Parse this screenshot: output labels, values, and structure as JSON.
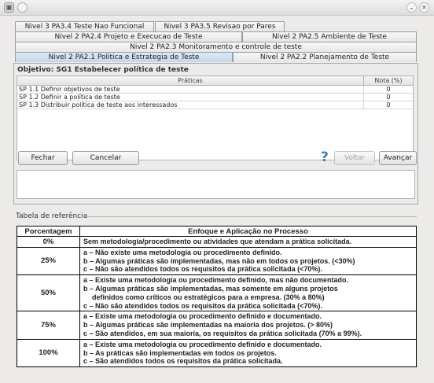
{
  "window": {
    "app_icon": "app-window-icon",
    "minimize_glyph": "⌄",
    "close_glyph": "✕"
  },
  "tabs": {
    "row1": [
      {
        "label": "Nivel 3 PA3.4 Teste Nao Funcional"
      },
      {
        "label": "Nivel 3 PA3.5 Revisao por Pares"
      }
    ],
    "row2": [
      {
        "label": "Nivel 2 PA2.4 Projeto e Execucao de Teste"
      },
      {
        "label": "Nivel 2 PA2.5 Ambiente de Teste"
      }
    ],
    "row3": [
      {
        "label": "Nivel 2 PA2.3 Monitoramento e controle de teste"
      }
    ],
    "row4": [
      {
        "label": "Nivel 2 PA2.1 Politica e Estrategia de Teste",
        "active": true
      },
      {
        "label": "Nivel 2 PA2.2 Planejamento de Teste"
      }
    ]
  },
  "panel": {
    "objective": "Objetivo: SG1 Estabelecer política de teste",
    "grid": {
      "columns": [
        "Práticas",
        "Nota (%)"
      ],
      "rows": [
        {
          "pratica": "SP 1.1 Definir objetivos de teste",
          "nota": "0"
        },
        {
          "pratica": "SP 1.2 Definir a política de teste",
          "nota": "0"
        },
        {
          "pratica": "SP 1.3 Distribuir política de teste aos interessados",
          "nota": "0"
        }
      ]
    },
    "buttons": {
      "fechar": "Fechar",
      "cancelar": "Cancelar",
      "help": "?",
      "voltar": "Voltar",
      "avancar": "Avançar"
    },
    "notes_text": ""
  },
  "reference": {
    "title": "Tabela de referência",
    "headers": [
      "Porcentagem",
      "Enfoque e Aplicação no Processo"
    ],
    "rows": [
      {
        "pct": "0%",
        "lines": [
          {
            "text": "Sem metodologia/procedimento ou atividades que atendam a prática solicitada."
          }
        ]
      },
      {
        "pct": "25%",
        "lines": [
          {
            "text": "a – Não existe uma metodologia ou procedimento definido."
          },
          {
            "text": "b – Algumas práticas são implementadas, mas não em todos os projetos. (<30%)"
          },
          {
            "text": "c – Não são atendidos todos os requisitos da prática solicitada (<70%)."
          }
        ]
      },
      {
        "pct": "50%",
        "lines": [
          {
            "text": "a – Existe uma metodologia ou procedimento definido, mas não documentado."
          },
          {
            "text": "b – Algumas práticas são implementadas, mas somente em alguns projetos"
          },
          {
            "text": "definidos como críticos ou estratégicos para a empresa. (30% a 80%)",
            "indent": true
          },
          {
            "text": "c – Não são atendidos todos os requisitos da prática solicitada (<70%)."
          }
        ]
      },
      {
        "pct": "75%",
        "lines": [
          {
            "text": "a – Existe uma metodologia ou procedimento definido e documentado."
          },
          {
            "text": "b – Algumas práticas são implementadas na maioria dos projetos. (> 80%)"
          },
          {
            "text": "c – São atendidos, em sua maioria, os requisitos da prática solicitada (70% a 99%)."
          }
        ]
      },
      {
        "pct": "100%",
        "lines": [
          {
            "text": "a – Existe uma metodologia ou procedimento definido e documentado."
          },
          {
            "text": "b – As práticas são implementadas em todos os projetos."
          },
          {
            "text": "c – São atendidos todos os requisitos da prática solicitada."
          }
        ]
      }
    ]
  }
}
